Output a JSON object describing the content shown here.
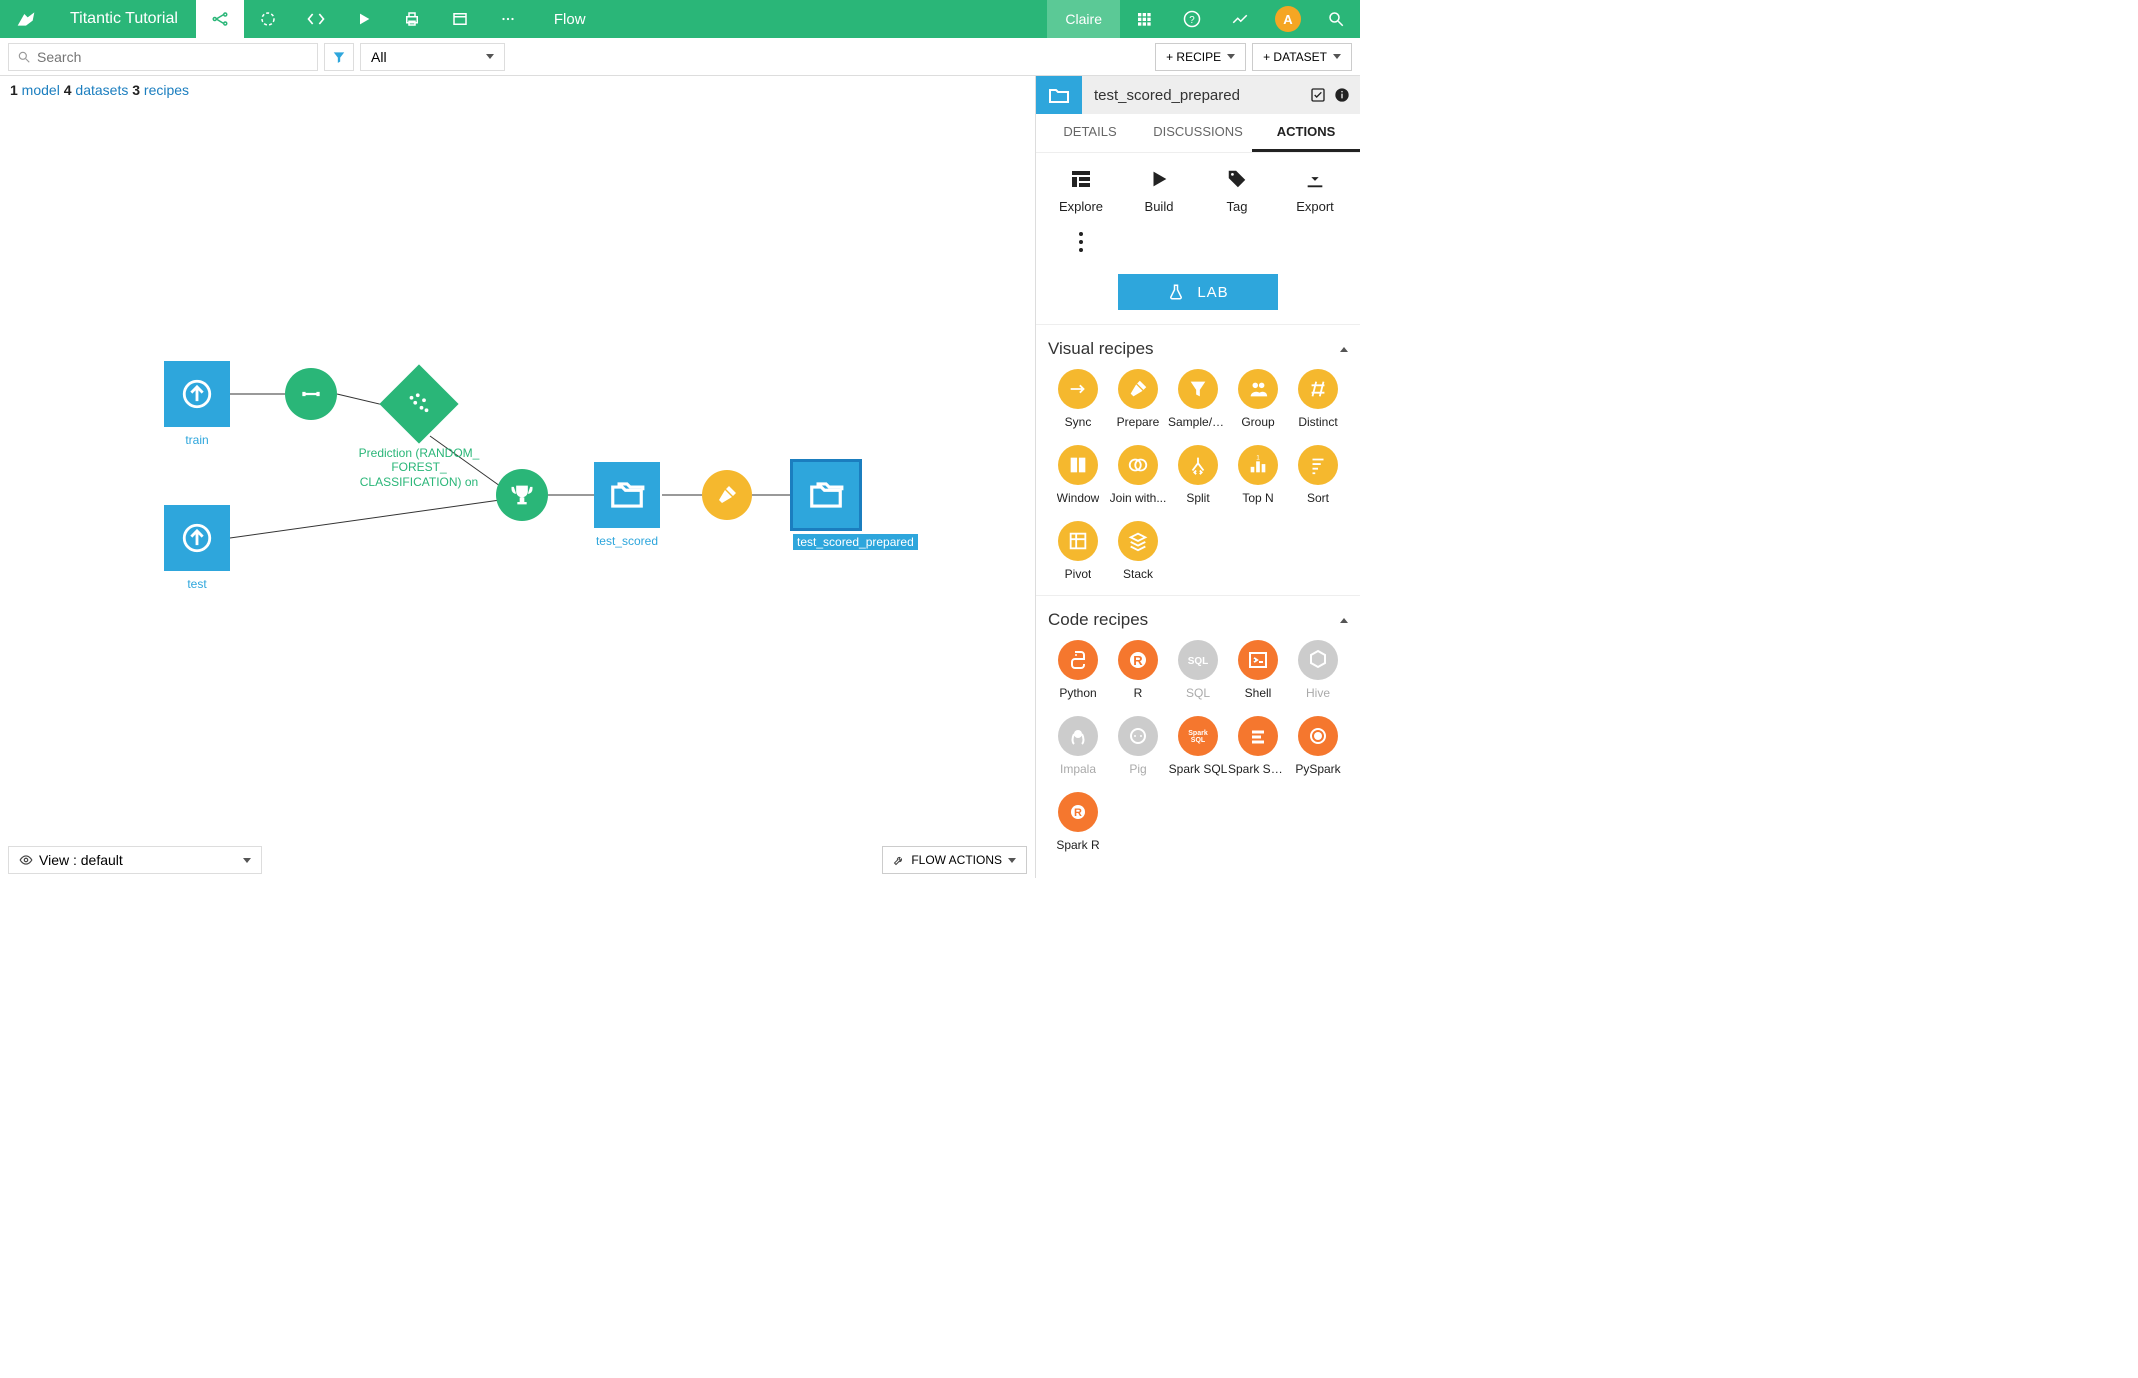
{
  "topbar": {
    "project_title": "Titantic Tutorial",
    "flow_label": "Flow",
    "user_name": "Claire",
    "avatar_initial": "A"
  },
  "toolbar": {
    "search_placeholder": "Search",
    "filter_label": "All",
    "recipe_btn": "+ RECIPE",
    "dataset_btn": "+ DATASET"
  },
  "summary": {
    "model_count": "1",
    "model_label": " model ",
    "dataset_count": "4",
    "dataset_label": " datasets ",
    "recipe_count": "3",
    "recipe_label": " recipes"
  },
  "flow": {
    "train_label": "train",
    "test_label": "test",
    "prediction_label": "Prediction (RANDOM_\nFOREST_\nCLASSIFICATION) on",
    "test_scored_label": "test_scored",
    "test_scored_prepared_label": "test_scored_prepared"
  },
  "bottombar": {
    "view_label": "View : default",
    "flow_actions_label": "FLOW ACTIONS"
  },
  "rpanel": {
    "header_title": "test_scored_prepared",
    "tabs": {
      "details": "DETAILS",
      "discussions": "DISCUSSIONS",
      "actions": "ACTIONS"
    },
    "actions": {
      "explore": "Explore",
      "build": "Build",
      "tag": "Tag",
      "export": "Export"
    },
    "lab_label": "LAB",
    "visual_title": "Visual recipes",
    "visual": [
      "Sync",
      "Prepare",
      "Sample/Filter",
      "Group",
      "Distinct",
      "Window",
      "Join with...",
      "Split",
      "Top N",
      "Sort",
      "Pivot",
      "Stack"
    ],
    "code_title": "Code recipes",
    "code": [
      {
        "label": "Python",
        "enabled": true
      },
      {
        "label": "R",
        "enabled": true
      },
      {
        "label": "SQL",
        "enabled": false
      },
      {
        "label": "Shell",
        "enabled": true
      },
      {
        "label": "Hive",
        "enabled": false
      },
      {
        "label": "Impala",
        "enabled": false
      },
      {
        "label": "Pig",
        "enabled": false
      },
      {
        "label": "Spark SQL",
        "enabled": true
      },
      {
        "label": "Spark Scala",
        "enabled": true
      },
      {
        "label": "PySpark",
        "enabled": true
      },
      {
        "label": "Spark R",
        "enabled": true
      }
    ]
  }
}
